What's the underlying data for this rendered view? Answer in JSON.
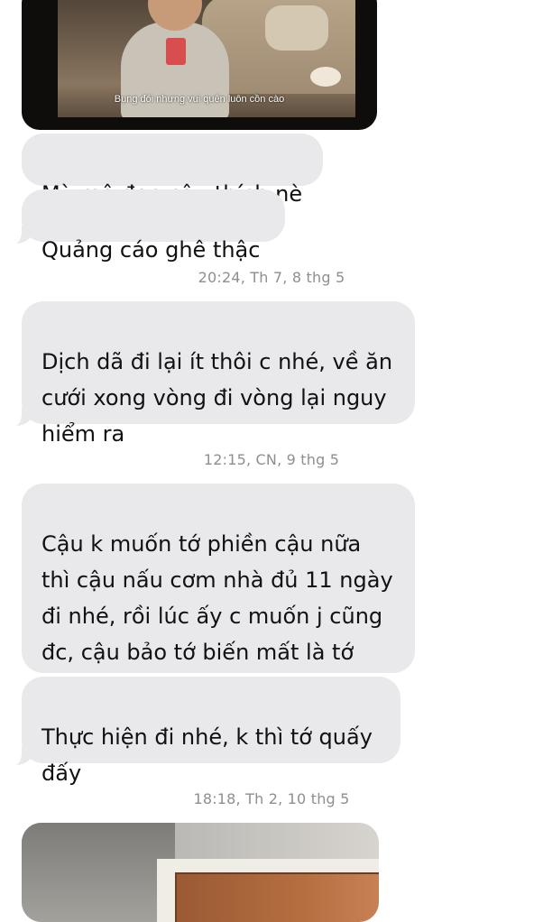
{
  "thread": {
    "video_message": {
      "subtitle": "Bụng đói nhưng vui quên luôn cồn cào"
    },
    "messages": [
      {
        "text": "Mỳ mô đen cậu thích nè"
      },
      {
        "text": "Quảng cáo ghê thậc"
      },
      {
        "timestamp": "20:24, Th 7, 8 thg 5"
      },
      {
        "text": "Dịch dã đi lại ít thôi c nhé, về ăn\ncưới xong vòng đi vòng lại nguy\nhiểm ra"
      },
      {
        "timestamp": "12:15, CN, 9 thg 5"
      },
      {
        "text": "Cậu k muốn tớ phiền cậu nữa\nthì cậu nấu cơm nhà đủ 11 ngày\nđi nhé, rồi lúc ấy c muốn j cũng\nđc, cậu bảo tớ biến mất là tớ\nbiến mất ạ"
      },
      {
        "text": "Thực hiện đi nhé, k thì tớ quấy\nđấy"
      },
      {
        "timestamp": "18:18, Th 2, 10 thg 5"
      }
    ]
  },
  "colors": {
    "bubble_background": "#e9e9eb",
    "timestamp_text": "#8e8e93",
    "message_text": "#111111",
    "page_background": "#ffffff"
  }
}
